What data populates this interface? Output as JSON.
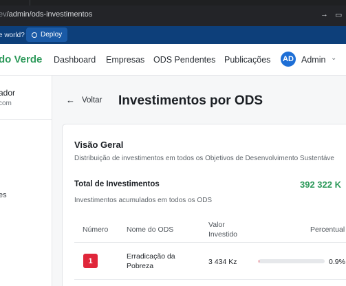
{
  "browser": {
    "url_dim": "ev",
    "url_path": "/admin/ods-investimentos",
    "bookmark_text": "e world?",
    "deploy_label": "Deploy"
  },
  "nav": {
    "brand": "do Verde",
    "links": [
      "Dashboard",
      "Empresas",
      "ODS Pendentes",
      "Publicações"
    ],
    "avatar_initials": "AD",
    "user_label": "Admin"
  },
  "sidebar": {
    "user_name": "ador",
    "user_email": "com",
    "item": "es"
  },
  "page": {
    "back_label": "Voltar",
    "title": "Investimentos por ODS"
  },
  "overview": {
    "title": "Visão Geral",
    "description": "Distribuição de investimentos em todos os Objetivos de Desenvolvimento Sustentáve",
    "total_label": "Total de Investimentos",
    "total_value": "392 322 K",
    "total_description": "Investimentos acumulados em todos os ODS"
  },
  "table": {
    "headers": {
      "numero": "Número",
      "nome": "Nome do ODS",
      "valor_line1": "Valor",
      "valor_line2": "Investido",
      "percentual": "Percentual"
    },
    "rows": [
      {
        "numero": "1",
        "nome_line1": "Erradicação da",
        "nome_line2": "Pobreza",
        "valor": "3 434 Kz",
        "percent_label": "0.9%",
        "percent_value": 0.9,
        "color": "#e0263a"
      }
    ]
  }
}
